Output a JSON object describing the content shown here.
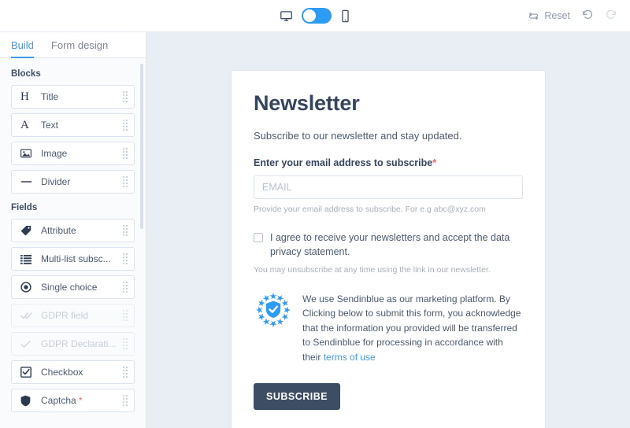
{
  "toolbar": {
    "desktop_icon": "desktop-monitor-icon",
    "mobile_icon": "mobile-phone-icon",
    "device_toggle_state": "desktop",
    "reset_label": "Reset",
    "reset_icon": "refresh-icon",
    "undo_icon": "undo-arrow-icon",
    "redo_icon": "redo-arrow-icon",
    "redo_disabled": true,
    "toggle_color": "#2d9cf5"
  },
  "sidebar": {
    "tabs": [
      {
        "label": "Build",
        "active": true
      },
      {
        "label": "Form design",
        "active": false
      }
    ],
    "groups": [
      {
        "label": "Blocks",
        "items": [
          {
            "label": "Title",
            "icon": "title-heading-icon",
            "glyph": "H",
            "disabled": false,
            "required": false
          },
          {
            "label": "Text",
            "icon": "text-icon",
            "glyph": "A",
            "disabled": false,
            "required": false
          },
          {
            "label": "Image",
            "icon": "image-icon",
            "glyph": "",
            "disabled": false,
            "required": false
          },
          {
            "label": "Divider",
            "icon": "divider-icon",
            "glyph": "",
            "disabled": false,
            "required": false
          }
        ]
      },
      {
        "label": "Fields",
        "items": [
          {
            "label": "Attribute",
            "icon": "tag-icon",
            "glyph": "",
            "disabled": false,
            "required": false
          },
          {
            "label": "Multi-list subsc...",
            "icon": "list-icon",
            "glyph": "",
            "disabled": false,
            "required": false
          },
          {
            "label": "Single choice",
            "icon": "radio-button-icon",
            "glyph": "",
            "disabled": false,
            "required": false
          },
          {
            "label": "GDPR field",
            "icon": "double-check-icon",
            "glyph": "",
            "disabled": true,
            "required": false
          },
          {
            "label": "GDPR Declarati...",
            "icon": "check-icon",
            "glyph": "",
            "disabled": true,
            "required": false
          },
          {
            "label": "Checkbox",
            "icon": "checkbox-icon",
            "glyph": "",
            "disabled": false,
            "required": false
          },
          {
            "label": "Captcha",
            "icon": "shield-icon",
            "glyph": "",
            "disabled": false,
            "required": true
          }
        ]
      }
    ],
    "required_marker": "*"
  },
  "form": {
    "title": "Newsletter",
    "subtitle": "Subscribe to our newsletter and stay updated.",
    "email_label": "Enter your email address to subscribe",
    "email_required_marker": "*",
    "email_placeholder": "EMAIL",
    "email_value": "",
    "email_helper": "Provide your email address to subscribe. For e.g abc@xyz.com",
    "consent_text": "I agree to receive your newsletters and accept the data privacy statement.",
    "consent_checked": false,
    "unsubscribe_note": "You may unsubscribe at any time using the link in our newsletter.",
    "gdpr_badge_icon": "gdpr-shield-stars-icon",
    "gdpr_text_before": "We use Sendinblue as our marketing platform. By Clicking below to submit this form, you acknowledge that the information you provided will be transferred to Sendinblue for processing in accordance with their ",
    "gdpr_link_text": "terms of use",
    "submit_label": "SUBSCRIBE",
    "submit_color": "#3d4d63"
  }
}
